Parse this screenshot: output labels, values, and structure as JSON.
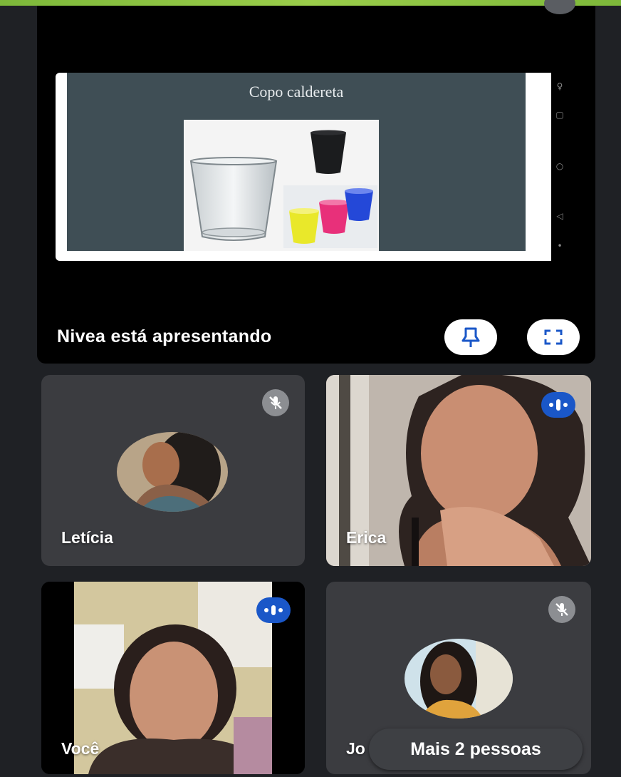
{
  "presentation": {
    "slide_title": "Copo caldereta",
    "presenter_label": "Nivea está apresentando",
    "pin_icon": "pin-icon",
    "fullscreen_icon": "fullscreen-icon"
  },
  "participants": [
    {
      "name": "Letícia",
      "mic": "muted"
    },
    {
      "name": "Erica",
      "mic": "speaking"
    },
    {
      "name": "Você",
      "mic": "speaking"
    },
    {
      "name": "Jo",
      "mic": "muted"
    }
  ],
  "more_people": "Mais 2 pessoas",
  "colors": {
    "background": "#1f2125",
    "tile": "#3b3c40",
    "accent_speaking": "#1a57c8",
    "muted_badge": "#8c8e92",
    "top_strip": "#8fc244"
  }
}
